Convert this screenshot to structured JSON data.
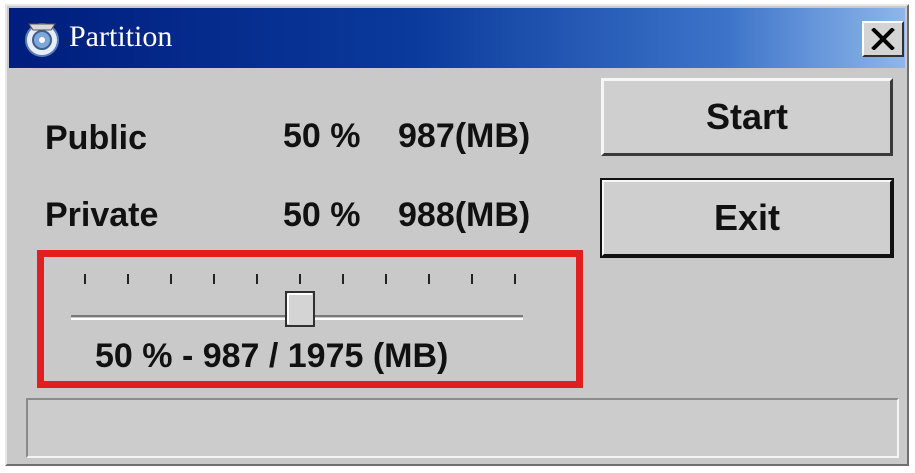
{
  "window": {
    "title": "Partition",
    "title_icon": "disc-icon",
    "close_icon": "close-icon"
  },
  "partitions": [
    {
      "label": "Public",
      "percent": "50 %",
      "size": "987(MB)"
    },
    {
      "label": "Private",
      "percent": "50 %",
      "size": "988(MB)"
    }
  ],
  "buttons": {
    "start": "Start",
    "exit": "Exit"
  },
  "slider": {
    "caption": "50 % - 987 / 1975 (MB)",
    "value_percent": 50,
    "tick_count": 11
  },
  "progress": {
    "fraction": 0
  },
  "colors": {
    "highlight": "#e0201e",
    "title_bar": "#0a3a9c"
  }
}
